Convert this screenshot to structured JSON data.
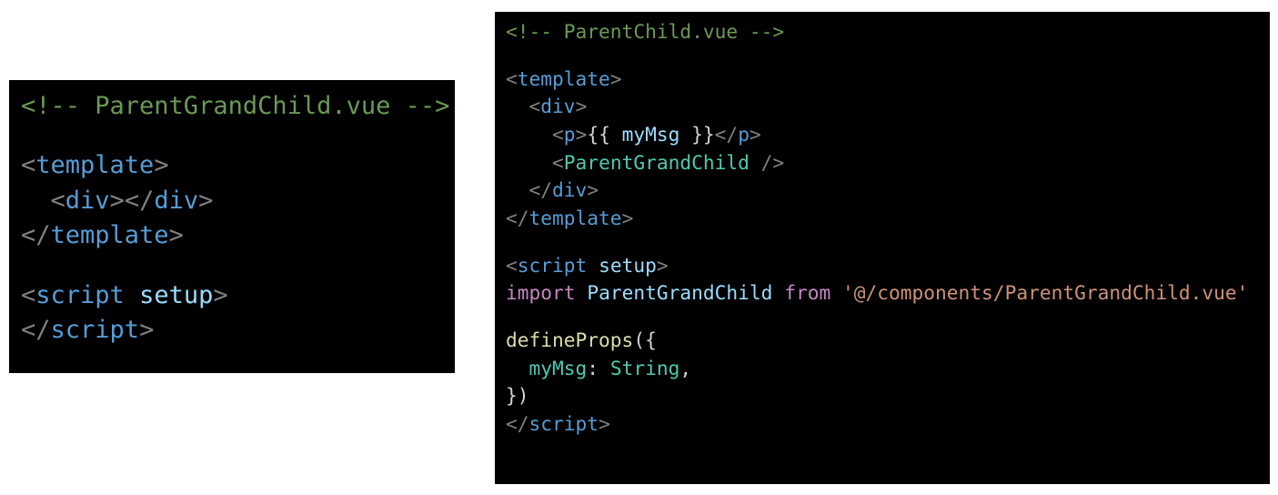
{
  "left_panel": {
    "title_comment": "<!-- ParentGrandChild.vue -->",
    "lines": [
      {
        "tokens": [
          {
            "c": "comment",
            "t": "<!-- ParentGrandChild.vue -->"
          }
        ]
      },
      {
        "tokens": []
      },
      {
        "tokens": [
          {
            "c": "punct",
            "t": "<"
          },
          {
            "c": "tag",
            "t": "template"
          },
          {
            "c": "punct",
            "t": ">"
          }
        ]
      },
      {
        "tokens": [
          {
            "c": "text",
            "t": "  "
          },
          {
            "c": "punct",
            "t": "<"
          },
          {
            "c": "tag",
            "t": "div"
          },
          {
            "c": "punct",
            "t": "></"
          },
          {
            "c": "tag",
            "t": "div"
          },
          {
            "c": "punct",
            "t": ">"
          }
        ]
      },
      {
        "tokens": [
          {
            "c": "punct",
            "t": "</"
          },
          {
            "c": "tag",
            "t": "template"
          },
          {
            "c": "punct",
            "t": ">"
          }
        ]
      },
      {
        "tokens": []
      },
      {
        "tokens": [
          {
            "c": "punct",
            "t": "<"
          },
          {
            "c": "tag",
            "t": "script"
          },
          {
            "c": "text",
            "t": " "
          },
          {
            "c": "attr",
            "t": "setup"
          },
          {
            "c": "punct",
            "t": ">"
          }
        ]
      },
      {
        "tokens": [
          {
            "c": "punct",
            "t": "</"
          },
          {
            "c": "tag",
            "t": "script"
          },
          {
            "c": "punct",
            "t": ">"
          }
        ]
      }
    ]
  },
  "right_panel": {
    "title_comment": "<!-- ParentChild.vue -->",
    "lines": [
      {
        "tokens": [
          {
            "c": "comment",
            "t": "<!-- ParentChild.vue -->"
          }
        ]
      },
      {
        "tokens": []
      },
      {
        "tokens": [
          {
            "c": "punct",
            "t": "<"
          },
          {
            "c": "tag",
            "t": "template"
          },
          {
            "c": "punct",
            "t": ">"
          }
        ]
      },
      {
        "tokens": [
          {
            "c": "text",
            "t": "  "
          },
          {
            "c": "punct",
            "t": "<"
          },
          {
            "c": "tag",
            "t": "div"
          },
          {
            "c": "punct",
            "t": ">"
          }
        ]
      },
      {
        "tokens": [
          {
            "c": "text",
            "t": "    "
          },
          {
            "c": "punct",
            "t": "<"
          },
          {
            "c": "tag",
            "t": "p"
          },
          {
            "c": "punct",
            "t": ">"
          },
          {
            "c": "text",
            "t": "{{ "
          },
          {
            "c": "ident",
            "t": "myMsg"
          },
          {
            "c": "text",
            "t": " }}"
          },
          {
            "c": "punct",
            "t": "</"
          },
          {
            "c": "tag",
            "t": "p"
          },
          {
            "c": "punct",
            "t": ">"
          }
        ]
      },
      {
        "tokens": [
          {
            "c": "text",
            "t": "    "
          },
          {
            "c": "punct",
            "t": "<"
          },
          {
            "c": "comp",
            "t": "ParentGrandChild"
          },
          {
            "c": "text",
            "t": " "
          },
          {
            "c": "punct",
            "t": "/>"
          }
        ]
      },
      {
        "tokens": [
          {
            "c": "text",
            "t": "  "
          },
          {
            "c": "punct",
            "t": "</"
          },
          {
            "c": "tag",
            "t": "div"
          },
          {
            "c": "punct",
            "t": ">"
          }
        ]
      },
      {
        "tokens": [
          {
            "c": "punct",
            "t": "</"
          },
          {
            "c": "tag",
            "t": "template"
          },
          {
            "c": "punct",
            "t": ">"
          }
        ]
      },
      {
        "tokens": []
      },
      {
        "tokens": [
          {
            "c": "punct",
            "t": "<"
          },
          {
            "c": "tag",
            "t": "script"
          },
          {
            "c": "text",
            "t": " "
          },
          {
            "c": "attr",
            "t": "setup"
          },
          {
            "c": "punct",
            "t": ">"
          }
        ]
      },
      {
        "tokens": [
          {
            "c": "keyword",
            "t": "import"
          },
          {
            "c": "text",
            "t": " "
          },
          {
            "c": "ident",
            "t": "ParentGrandChild"
          },
          {
            "c": "text",
            "t": " "
          },
          {
            "c": "keyword",
            "t": "from"
          },
          {
            "c": "text",
            "t": " "
          },
          {
            "c": "string",
            "t": "'@/components/ParentGrandChild.vue'"
          }
        ]
      },
      {
        "tokens": []
      },
      {
        "tokens": [
          {
            "c": "func",
            "t": "defineProps"
          },
          {
            "c": "text",
            "t": "({"
          }
        ]
      },
      {
        "tokens": [
          {
            "c": "text",
            "t": "  "
          },
          {
            "c": "prop",
            "t": "myMsg"
          },
          {
            "c": "text",
            "t": ": "
          },
          {
            "c": "type",
            "t": "String"
          },
          {
            "c": "text",
            "t": ","
          }
        ]
      },
      {
        "tokens": [
          {
            "c": "text",
            "t": "})"
          }
        ]
      },
      {
        "tokens": [
          {
            "c": "punct",
            "t": "</"
          },
          {
            "c": "tag",
            "t": "script"
          },
          {
            "c": "punct",
            "t": ">"
          }
        ]
      }
    ]
  },
  "colors": {
    "background": "#000000",
    "comment": "#6a9955",
    "punct": "#808080",
    "tag": "#569cd6",
    "component": "#4ec9b0",
    "attr": "#9cdcfe",
    "keyword": "#c586c0",
    "string": "#ce9178",
    "function": "#dcdcaa"
  }
}
